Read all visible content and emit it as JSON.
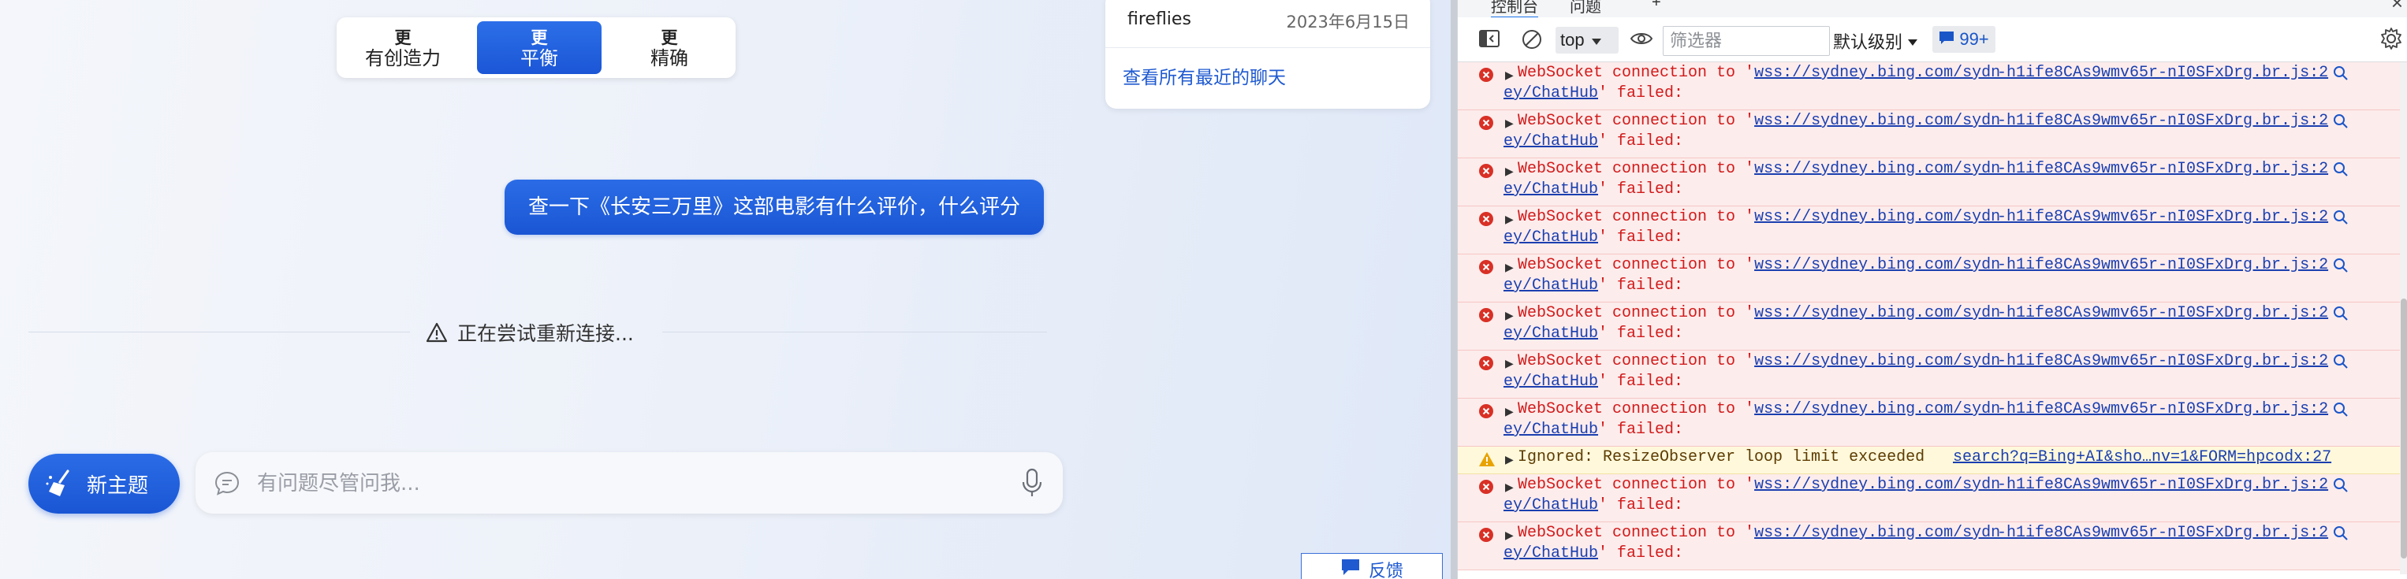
{
  "chat": {
    "styles": [
      {
        "line1": "更",
        "line2": "有创造力",
        "active": false
      },
      {
        "line1": "更",
        "line2": "平衡",
        "active": true
      },
      {
        "line1": "更",
        "line2": "精确",
        "active": false
      }
    ],
    "recent": {
      "name": "fireflies",
      "date": "2023年6月15日",
      "link": "查看所有最近的聊天"
    },
    "user_message": "查一下《长安三万里》这部电影有什么评价，什么评分",
    "reconnect_text": "正在尝试重新连接...",
    "new_topic_label": "新主题",
    "ask_placeholder": "有问题尽管问我...",
    "feedback_label": "反馈"
  },
  "devtools": {
    "tabs": [
      "控制台",
      "问题",
      "+"
    ],
    "context": "top",
    "filter_placeholder": "筛选器",
    "levels_label": "默认级别",
    "issues_count": "99+",
    "log": [
      {
        "type": "error",
        "prefix": "WebSocket connection to '",
        "url": "wss://sydney.bing.com/sydn",
        "cont": "ey/ChatHub",
        "suffix": "' failed:",
        "source": "-h1ife8CAs9wmv65r-nI0SFxDrg.br.js:2"
      },
      {
        "type": "error",
        "prefix": "WebSocket connection to '",
        "url": "wss://sydney.bing.com/sydn",
        "cont": "ey/ChatHub",
        "suffix": "' failed:",
        "source": "-h1ife8CAs9wmv65r-nI0SFxDrg.br.js:2"
      },
      {
        "type": "error",
        "prefix": "WebSocket connection to '",
        "url": "wss://sydney.bing.com/sydn",
        "cont": "ey/ChatHub",
        "suffix": "' failed:",
        "source": "-h1ife8CAs9wmv65r-nI0SFxDrg.br.js:2"
      },
      {
        "type": "error",
        "prefix": "WebSocket connection to '",
        "url": "wss://sydney.bing.com/sydn",
        "cont": "ey/ChatHub",
        "suffix": "' failed:",
        "source": "-h1ife8CAs9wmv65r-nI0SFxDrg.br.js:2"
      },
      {
        "type": "error",
        "prefix": "WebSocket connection to '",
        "url": "wss://sydney.bing.com/sydn",
        "cont": "ey/ChatHub",
        "suffix": "' failed:",
        "source": "-h1ife8CAs9wmv65r-nI0SFxDrg.br.js:2"
      },
      {
        "type": "error",
        "prefix": "WebSocket connection to '",
        "url": "wss://sydney.bing.com/sydn",
        "cont": "ey/ChatHub",
        "suffix": "' failed:",
        "source": "-h1ife8CAs9wmv65r-nI0SFxDrg.br.js:2"
      },
      {
        "type": "error",
        "prefix": "WebSocket connection to '",
        "url": "wss://sydney.bing.com/sydn",
        "cont": "ey/ChatHub",
        "suffix": "' failed:",
        "source": "-h1ife8CAs9wmv65r-nI0SFxDrg.br.js:2"
      },
      {
        "type": "error",
        "prefix": "WebSocket connection to '",
        "url": "wss://sydney.bing.com/sydn",
        "cont": "ey/ChatHub",
        "suffix": "' failed:",
        "source": "-h1ife8CAs9wmv65r-nI0SFxDrg.br.js:2"
      },
      {
        "type": "warn",
        "text": "Ignored: ResizeObserver loop limit exceeded",
        "source": "search?q=Bing+AI&sho…nv=1&FORM=hpcodx:27"
      },
      {
        "type": "error",
        "prefix": "WebSocket connection to '",
        "url": "wss://sydney.bing.com/sydn",
        "cont": "ey/ChatHub",
        "suffix": "' failed:",
        "source": "-h1ife8CAs9wmv65r-nI0SFxDrg.br.js:2"
      },
      {
        "type": "error",
        "prefix": "WebSocket connection to '",
        "url": "wss://sydney.bing.com/sydn",
        "cont": "ey/ChatHub",
        "suffix": "' failed:",
        "source": "-h1ife8CAs9wmv65r-nI0SFxDrg.br.js:2"
      }
    ],
    "prompt": "›"
  },
  "colors": {
    "accent": "#1b56d6",
    "error": "#d21a1a",
    "link": "#1a3fb0",
    "warn_bg": "#fff8db",
    "error_bg": "#fdecec"
  }
}
